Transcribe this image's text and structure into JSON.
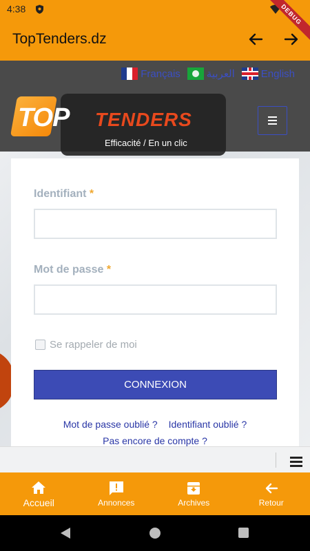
{
  "status_bar": {
    "time": "4:38",
    "debug_label": "DEBUG"
  },
  "app_bar": {
    "title": "TopTenders.dz"
  },
  "header": {
    "languages": [
      {
        "label": "Français",
        "flag": "flag-france"
      },
      {
        "label": "العربية",
        "flag": "flag-algeria"
      },
      {
        "label": "English",
        "flag": "flag-uk"
      }
    ],
    "logo_top": "TOP",
    "logo_tenders": "TENDERS",
    "tagline": "Efficacité / En un clic"
  },
  "login": {
    "username_label": "Identifiant",
    "password_label": "Mot de passe",
    "required_mark": "*",
    "username_value": "",
    "password_value": "",
    "remember_label": "Se rappeler de moi",
    "submit_label": "CONNEXION",
    "forgot_password": "Mot de passe oublié ?",
    "forgot_username": "Identifiant oublié ?",
    "no_account": "Pas encore de compte ?"
  },
  "bottom_nav": {
    "items": [
      {
        "label": "Accueil",
        "icon": "home-icon",
        "active": true
      },
      {
        "label": "Annonces",
        "icon": "announcement-icon",
        "active": false
      },
      {
        "label": "Archives",
        "icon": "archive-icon",
        "active": false
      },
      {
        "label": "Retour",
        "icon": "arrow-back-icon",
        "active": false
      }
    ]
  },
  "colors": {
    "accent": "#f5990a",
    "primary_button": "#3c4bb5",
    "link": "#2936a6"
  }
}
